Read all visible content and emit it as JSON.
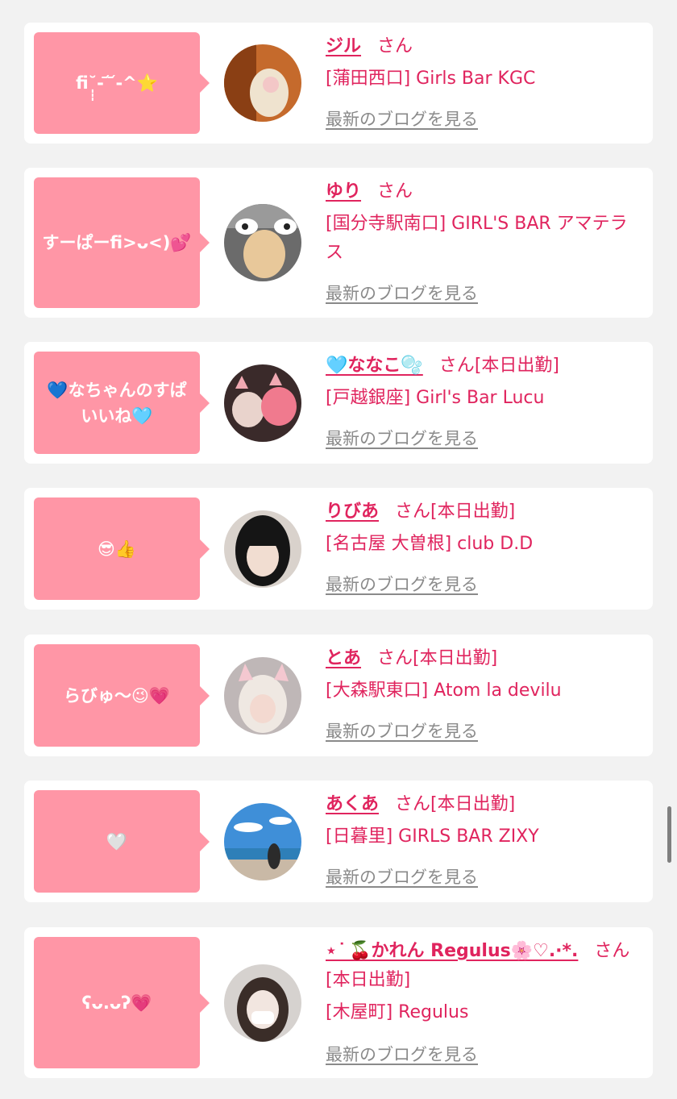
{
  "theme": {
    "accent": "#e0245e",
    "bubble": "#ff96a6",
    "link_gray": "#8a8a8a",
    "background": "#f2f2f2"
  },
  "blog_link_label": "最新のブログを見る",
  "cards": [
    {
      "message": "ﬁ⁠˘̩̩̩-  ᷄ ᷄-^⭐️",
      "name": "ジル",
      "honorific": "さん",
      "status": "",
      "store": "[蒲田西口] Girls Bar KGC",
      "blog": "最新のブログを見る",
      "avatar_icon": "avatar-photo-mirror-selfie"
    },
    {
      "message": "すーぱーﬁ>ᴗ<)💕",
      "name": "ゆり",
      "honorific": "さん",
      "status": "",
      "store": "[国分寺駅南口] GIRL'S BAR アマテラス",
      "blog": "最新のブログを見る",
      "avatar_icon": "avatar-photo-cow-ears"
    },
    {
      "message": "💙なちゃんのすぱいいね🩵",
      "name": "🩵ななこ🫧",
      "honorific": "さん",
      "status": "[本日出勤]",
      "store": "[戸越銀座] Girl's Bar Lucu",
      "blog": "最新のブログを見る",
      "avatar_icon": "avatar-photo-cat-ears"
    },
    {
      "message": "😎👍",
      "name": "りびあ",
      "honorific": "さん",
      "status": "[本日出勤]",
      "store": "[名古屋 大曽根] club D.D",
      "blog": "最新のブログを見る",
      "avatar_icon": "avatar-photo-portrait"
    },
    {
      "message": "らびゅ〜😉💗",
      "name": "とあ",
      "honorific": "さん",
      "status": "[本日出勤]",
      "store": "[大森駅東口] Atom la devilu",
      "blog": "最新のブログを見る",
      "avatar_icon": "avatar-photo-bunny-ears"
    },
    {
      "message": "🤍",
      "name": "あくあ",
      "honorific": "さん",
      "status": "[本日出勤]",
      "store": "[日暮里] GIRLS BAR ZIXY",
      "blog": "最新のブログを見る",
      "avatar_icon": "avatar-photo-beach"
    },
    {
      "message": "ʕᴗ.ᴗʔ💗",
      "name": "⋆ ͘ 🍒かれん Regulus🌸♡.·*.",
      "honorific": "さん",
      "status": "[本日出勤]",
      "store": "[木屋町] Regulus",
      "blog": "最新のブログを見る",
      "avatar_icon": "avatar-photo-masked-selfie"
    }
  ]
}
